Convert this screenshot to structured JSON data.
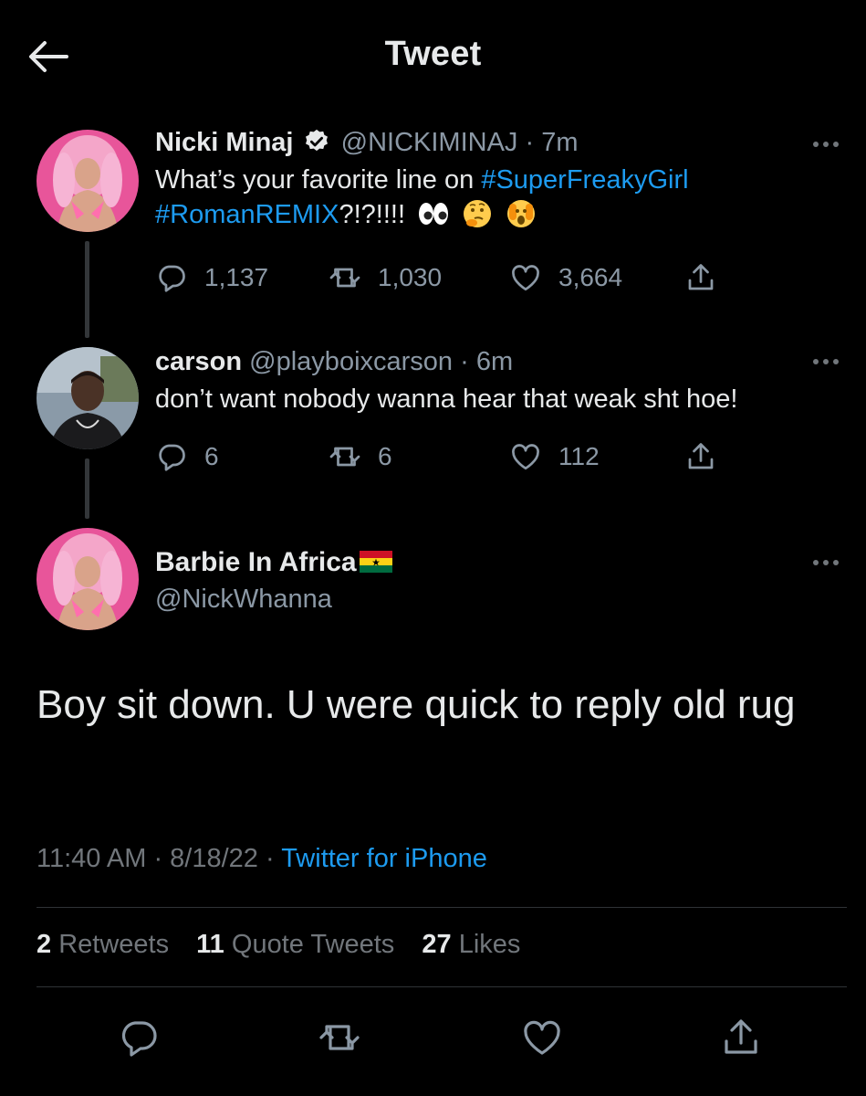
{
  "header": {
    "title": "Tweet"
  },
  "tweets": [
    {
      "name": "Nicki Minaj",
      "handle": "@NICKIMINAJ",
      "time": "· 7m",
      "text_plain": "What’s your favorite line on ",
      "hashtag1": "#SuperFreakyGirl",
      "hashtag2": "#RomanREMIX",
      "text_tail": "?!?!!!!",
      "replies": "1,137",
      "retweets": "1,030",
      "likes": "3,664"
    },
    {
      "name": "carson",
      "handle": "@playboixcarson",
      "time": "· 6m",
      "text": "don’t want nobody wanna hear that weak sht hoe!",
      "replies": "6",
      "retweets": "6",
      "likes": "112"
    }
  ],
  "main_tweet": {
    "name": "Barbie In Africa",
    "handle": "@NickWhanna",
    "text": "Boy sit down. U were quick to reply old rug",
    "time": "11:40 AM",
    "date": "· 8/18/22 ·",
    "source": "Twitter for iPhone",
    "retweets_count": "2",
    "retweets_label": "Retweets",
    "quotes_count": "11",
    "quotes_label": "Quote Tweets",
    "likes_count": "27",
    "likes_label": "Likes"
  },
  "colors": {
    "accent": "#1d9bf0",
    "background": "#000000",
    "muted": "#71767b"
  },
  "icons": [
    "back-arrow-icon",
    "verified-badge-icon",
    "more-icon",
    "reply-icon",
    "retweet-icon",
    "like-icon",
    "share-icon",
    "ghana-flag-icon"
  ]
}
